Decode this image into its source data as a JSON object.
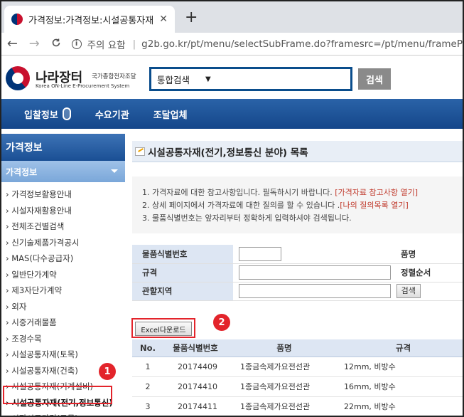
{
  "browser": {
    "tab_title": "가격정보:가격정보:시설공통자재",
    "tab_close": "✕",
    "new_tab": "+",
    "back": "←",
    "forward": "→",
    "reload": "C",
    "secure_label": "주의 요함",
    "url": "g2b.go.kr/pt/menu/selectSubFrame.do?framesrc=/pt/menu/frameP"
  },
  "site": {
    "brand_title": "나라장터",
    "brand_sub": "국가종합전자조달",
    "brand_en": "Korea ON-Line E-Procurement System",
    "search_scope": "통합검색",
    "search_arrow": "▼",
    "search_button": "검색"
  },
  "topnav": {
    "items": [
      "입찰정보",
      "수요기관",
      "조달업체"
    ]
  },
  "sidebar": {
    "title": "가격정보",
    "section": "가격정보",
    "items": [
      "› 가격정보활용안내",
      "› 시설자재활용안내",
      "› 전체조건별검색",
      "› 신기술제품가격공시",
      "› MAS(다수공급자)",
      "› 일반단가계약",
      "› 제3자단가계약",
      "› 외자",
      "› 시중거래물품",
      "› 조경수목",
      "› 시설공통자재(토목)",
      "› 시설공통자재(건축)",
      "› 시설공통자재(기계설비)",
      "› 시설공통자재(전기,정보통신)",
      "› 시장시공가격(토목)"
    ]
  },
  "main": {
    "title": "시설공통자재(전기,정보통신 분야) 목록",
    "notices": [
      {
        "text": "1. 가격자료에 대한 참고사항입니다. 필독하시기 바랍니다. ",
        "link": "[가격자료 참고사항 열기]"
      },
      {
        "text": "2. 상세 페이지에서 가격자료에 대한 질의를 할 수 있습니다 .",
        "link": "[나의 질의목록 열기]"
      },
      {
        "text": "3. 물품식별번호는 앞자리부터 정확하게 입력하셔야 검색됩니다.",
        "link": ""
      }
    ],
    "form": {
      "item_id_label": "물품식별번호",
      "item_name_label": "품명",
      "spec_label": "규격",
      "sort_label": "정렬순서",
      "region_label": "관할지역",
      "search_button": "검색"
    },
    "excel_button": "Excel다운로드",
    "table": {
      "headers": [
        "No.",
        "물품식별번호",
        "품명",
        "규격"
      ],
      "rows": [
        [
          "1",
          "20174409",
          "1종금속제가요전선관",
          "12mm, 비방수"
        ],
        [
          "2",
          "20174410",
          "1종금속제가요전선관",
          "16mm, 비방수"
        ],
        [
          "3",
          "20174411",
          "1종금속제가요전선관",
          "22mm, 비방수"
        ]
      ]
    }
  },
  "annotations": {
    "badge1": "1",
    "badge2": "2"
  },
  "colors": {
    "nav_blue": "#14468a",
    "highlight_red": "#e3242b",
    "link_blue": "#1f52a4",
    "notice_red": "#c0392b"
  }
}
